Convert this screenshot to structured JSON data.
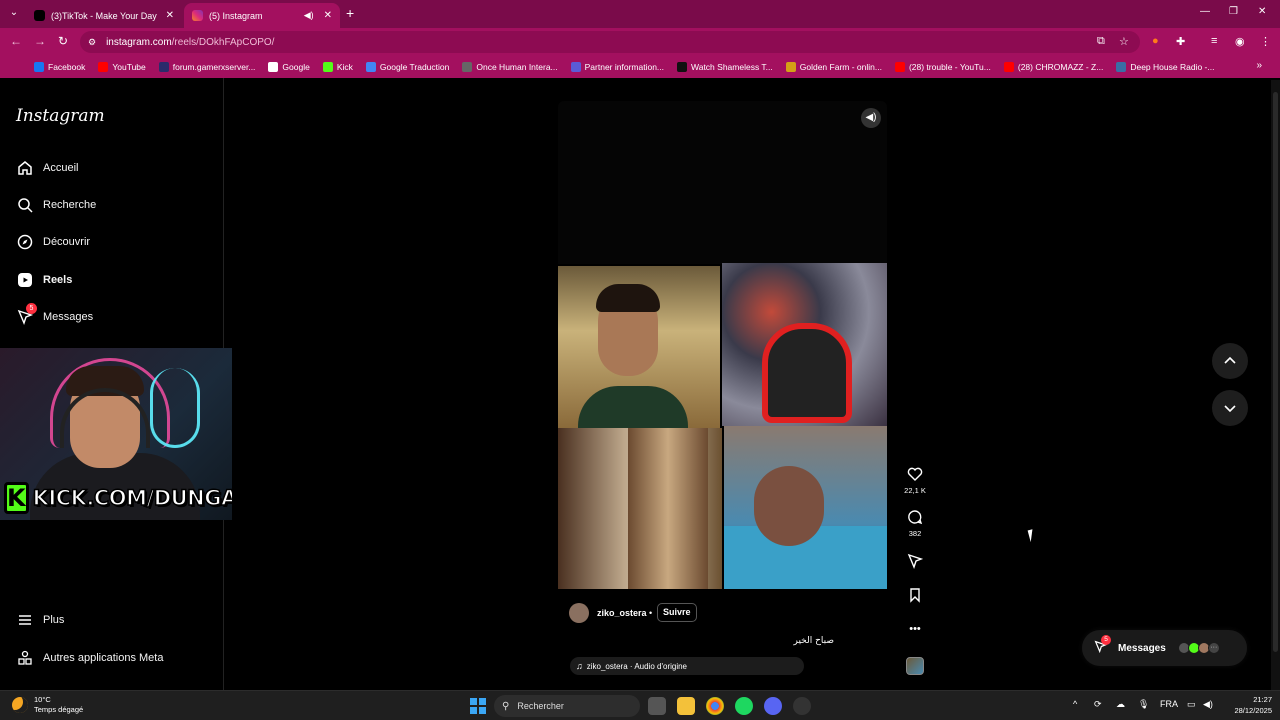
{
  "browser": {
    "tabs": [
      {
        "title": "(3)TikTok - Make Your Day"
      },
      {
        "title": "(5) Instagram"
      }
    ],
    "address": {
      "site": "instagram.com",
      "path": "/reels/DOkhFApCOPO/"
    },
    "bookmarks": [
      {
        "label": "Facebook",
        "color": "#1877f2"
      },
      {
        "label": "YouTube",
        "color": "#ff0000"
      },
      {
        "label": "forum.gamerxserver...",
        "color": "#2b2b6b"
      },
      {
        "label": "Google",
        "color": "#ffffff"
      },
      {
        "label": "Kick",
        "color": "#53fc18"
      },
      {
        "label": "Google Traduction",
        "color": "#4285f4"
      },
      {
        "label": "Once Human Intera...",
        "color": "#666666"
      },
      {
        "label": "Partner information...",
        "color": "#5b5bd6"
      },
      {
        "label": "Watch Shameless T...",
        "color": "#111111"
      },
      {
        "label": "Golden Farm - onlin...",
        "color": "#d4a017"
      },
      {
        "label": "(28) trouble - YouTu...",
        "color": "#ff0000"
      },
      {
        "label": "(28) CHROMAZZ - Z...",
        "color": "#ff0000"
      },
      {
        "label": "Deep House Radio -...",
        "color": "#3a6ea5"
      }
    ]
  },
  "instagram": {
    "logo": "Instagram",
    "nav": [
      {
        "label": "Accueil",
        "icon": "home-icon"
      },
      {
        "label": "Recherche",
        "icon": "search-icon"
      },
      {
        "label": "Découvrir",
        "icon": "compass-icon"
      },
      {
        "label": "Reels",
        "icon": "reels-icon"
      },
      {
        "label": "Messages",
        "icon": "messages-icon",
        "badge": "5"
      }
    ],
    "bottom_nav": [
      {
        "label": "Plus",
        "icon": "menu-icon"
      },
      {
        "label": "Autres applications Meta",
        "icon": "meta-apps-icon"
      }
    ],
    "reel": {
      "username": "ziko_ostera",
      "separator": "•",
      "follow_label": "Suivre",
      "caption": "صباح الخير",
      "audio": "ziko_ostera · Audio d'origine",
      "likes": "22,1 K",
      "comments": "382"
    },
    "messages_pill": {
      "label": "Messages",
      "badge": "5"
    }
  },
  "overlay": {
    "kick_text": "KICK.COM/DUNGAA",
    "kick_logo": "K",
    "kick_color": "#53fc18"
  },
  "taskbar": {
    "weather_temp": "10°C",
    "weather_desc": "Temps dégagé",
    "search_placeholder": "Rechercher",
    "language": "FRA",
    "time": "21:27",
    "date": "28/12/2025"
  }
}
